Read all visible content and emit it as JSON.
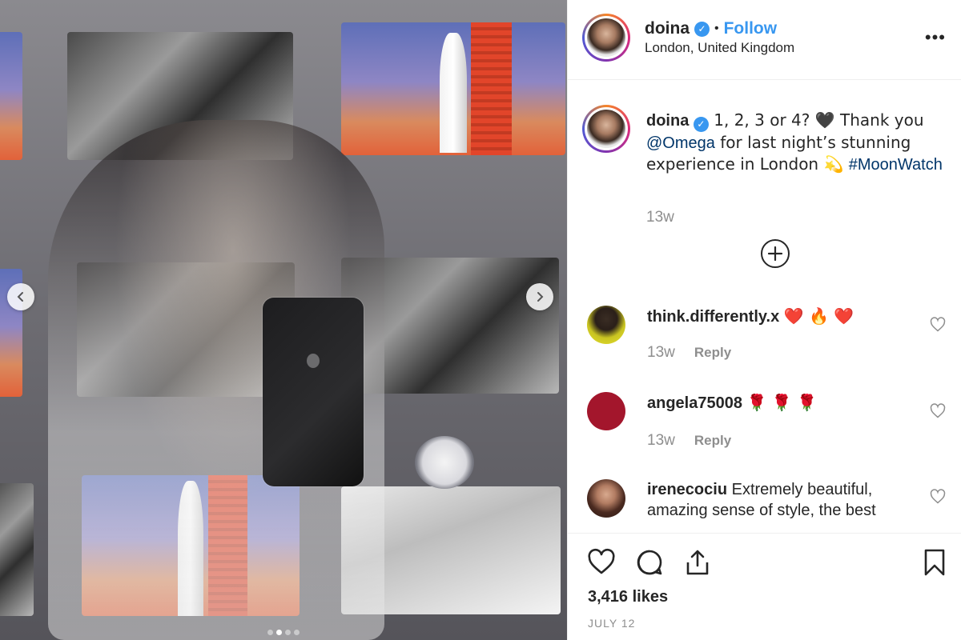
{
  "post": {
    "username": "doina",
    "verified_mark": "✓",
    "follow_label": "Follow",
    "separator": "•",
    "location": "London, United Kingdom",
    "more_label": "•••",
    "carousel": {
      "total": 4,
      "active": 2
    }
  },
  "caption": {
    "username": "doina",
    "text_part1": " 1, 2, 3 or 4? 🖤  Thank you ",
    "mention": "@Omega",
    "text_part2": " for last night’s stunning experience in London 💫 ",
    "hashtag": "#MoonWatch",
    "time": "13w"
  },
  "comments": [
    {
      "username": "think.differently.x",
      "text": "❤️ 🔥 ❤️",
      "time": "13w",
      "reply_label": "Reply"
    },
    {
      "username": "angela75008",
      "text": "🌹 🌹 🌹",
      "time": "13w",
      "reply_label": "Reply"
    },
    {
      "username": "irenecociu",
      "text": "Extremely beautiful, amazing sense of style, the best"
    }
  ],
  "actions": {
    "likes": "3,416 likes",
    "date": "JULY 12"
  },
  "colors": {
    "link": "#003569",
    "follow": "#3897f0",
    "muted": "#8e8e8e",
    "verified": "#3897f0",
    "text": "#262626"
  },
  "icons": [
    "chevron-left-icon",
    "chevron-right-icon",
    "verified-badge-icon",
    "more-icon",
    "add-circle-icon",
    "heart-icon",
    "comment-icon",
    "share-icon",
    "bookmark-icon"
  ]
}
